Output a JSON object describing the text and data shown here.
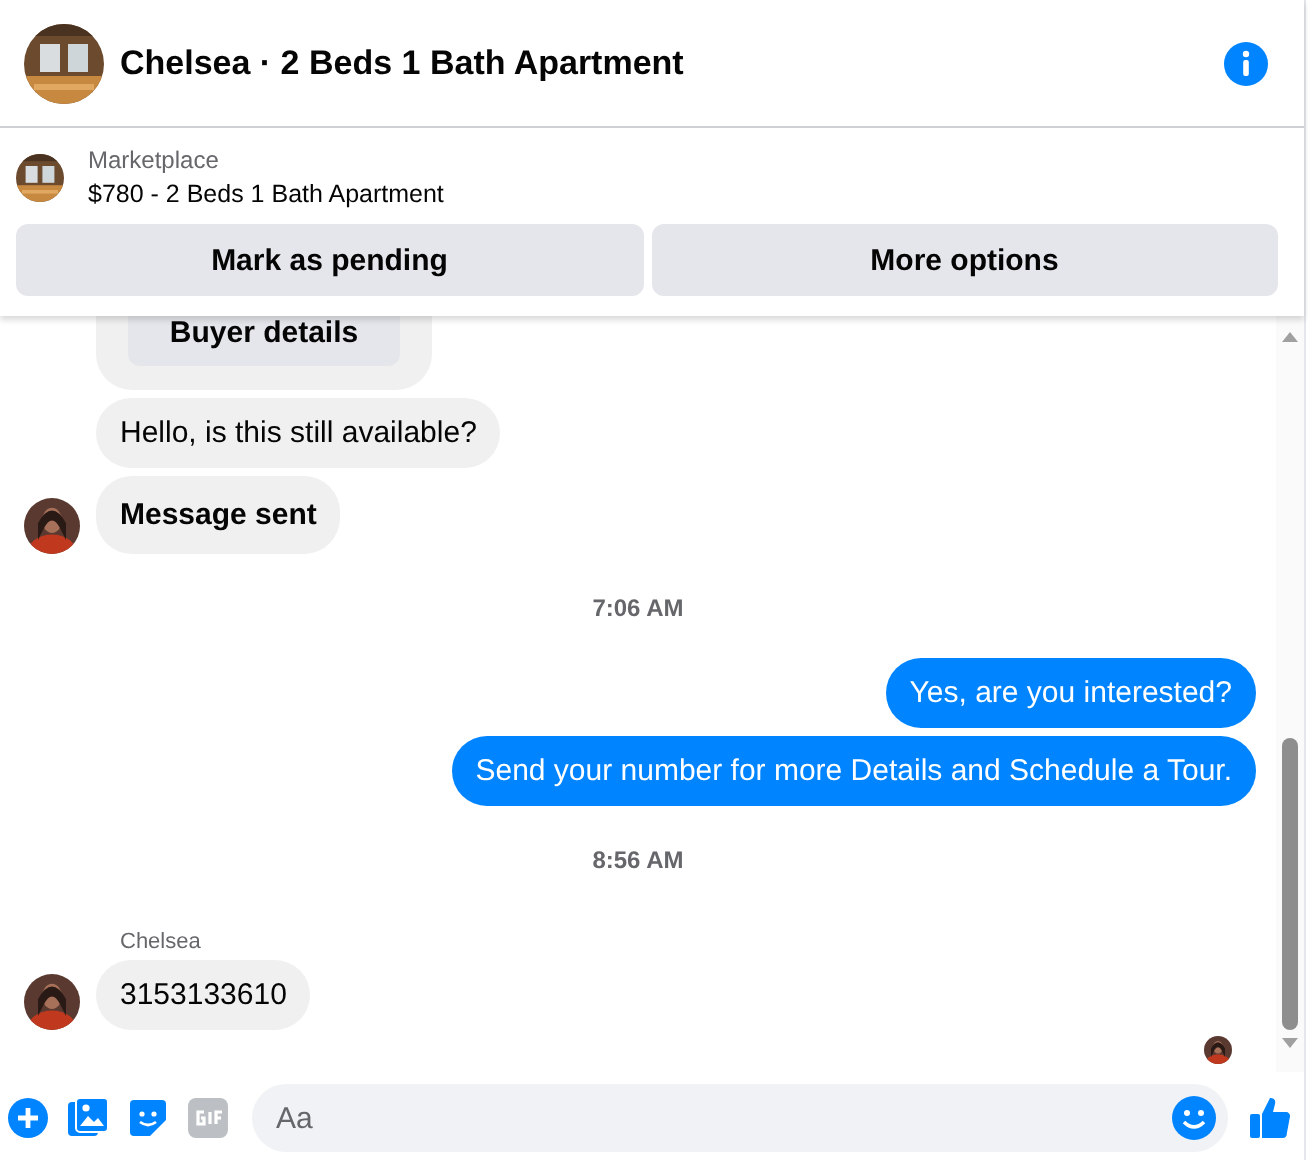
{
  "header": {
    "title": "Chelsea · 2 Beds 1 Bath Apartment"
  },
  "listing": {
    "source": "Marketplace",
    "title": "$780 - 2 Beds 1 Bath Apartment",
    "buttons": [
      "Mark as pending",
      "More options"
    ]
  },
  "messages": [
    {
      "kind": "card",
      "button": "Buyer details"
    },
    {
      "kind": "incoming",
      "text": "Hello, is this still available?"
    },
    {
      "kind": "incoming",
      "text": "Message sent",
      "bold": true,
      "avatar": true
    },
    {
      "kind": "time",
      "text": "7:06 AM"
    },
    {
      "kind": "outgoing",
      "text": "Yes, are you interested?"
    },
    {
      "kind": "outgoing",
      "text": "Send your number for more Details and Schedule a Tour."
    },
    {
      "kind": "time",
      "text": "8:56 AM"
    },
    {
      "kind": "sender",
      "text": "Chelsea"
    },
    {
      "kind": "incoming",
      "text": "3153133610",
      "avatar": true
    }
  ],
  "composer": {
    "placeholder": "Aa"
  }
}
